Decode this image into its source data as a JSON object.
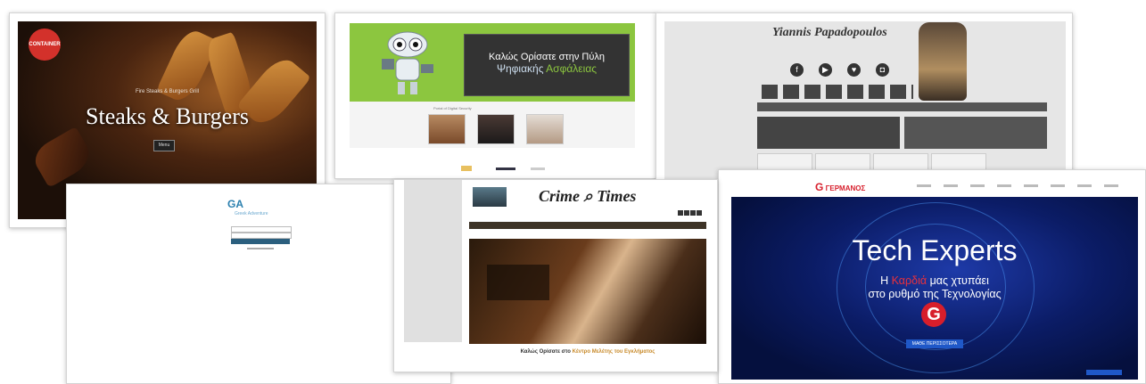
{
  "steaks": {
    "badge": "CONTAINER",
    "tagline": "Fire Steaks & Burgers Grill",
    "title": "Steaks & Burgers",
    "button": "Menu"
  },
  "security": {
    "line1": "Καλώς Ορίσατε στην Πύλη",
    "line2_a": "Ψηφιακής ",
    "line2_b": "Ασφάλειας",
    "caption": "Portal of Digital Security"
  },
  "guitar": {
    "name": "Yiannis Papadopoulos",
    "social": [
      "f",
      "▶",
      "♥",
      "◘"
    ]
  },
  "login": {
    "logo": "GA",
    "brand": "Greek Adventure"
  },
  "crime": {
    "logo_word_1": "Crime",
    "logo_word_2": "Times",
    "welcome_a": "Καλώς Ορίσατε στο ",
    "welcome_b": "Κέντρο Μελέτης του Εγκλήματος"
  },
  "tech": {
    "brand": "ΓΕΡΜΑΝΟΣ",
    "title": "Tech Experts",
    "line1_a": "Η ",
    "line1_b": "Καρδιά",
    "line1_c": " μας χτυπάει",
    "line2": "στο ρυθμό της Τεχνολογίας",
    "g": "G",
    "cta": "ΜΑΘΕ ΠΕΡΙΣΣΟΤΕΡΑ"
  }
}
